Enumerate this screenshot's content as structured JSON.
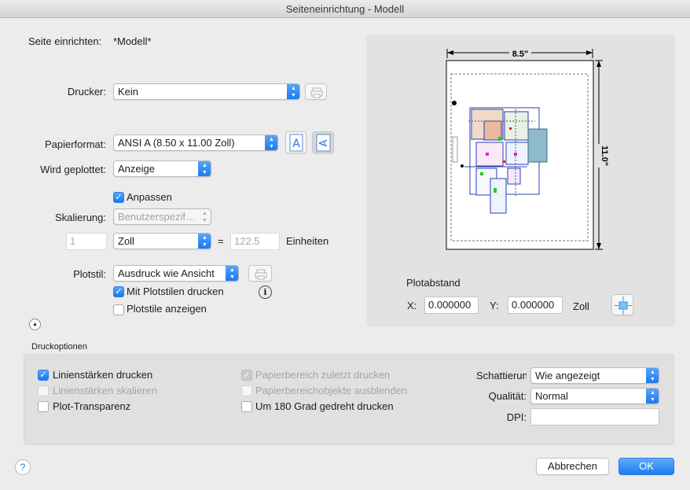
{
  "window": {
    "title": "Seiteneinrichtung - Modell"
  },
  "setup": {
    "label": "Seite einrichten:",
    "value": "*Modell*"
  },
  "printer": {
    "label": "Drucker:",
    "value": "Kein",
    "properties_icon": "printer-properties-icon"
  },
  "paper": {
    "label": "Papierformat:",
    "value": "ANSI A (8.50 x 11.00 Zoll)",
    "portrait_icon": "portrait-orientation-icon",
    "landscape_icon": "landscape-orientation-icon"
  },
  "plot_area": {
    "label": "Wird geplottet:",
    "value": "Anzeige"
  },
  "fit": {
    "label": "Anpassen",
    "checked": true
  },
  "scale": {
    "label": "Skalierung:",
    "preset": "Benutzerspezif…",
    "value_left": "1",
    "unit": "Zoll",
    "equals": "=",
    "value_right": "122.5",
    "units_label": "Einheiten"
  },
  "plotstyle": {
    "label": "Plotstil:",
    "value": "Ausdruck wie Ansicht",
    "edit_icon": "plotstyle-edit-icon",
    "info_icon": "info-icon",
    "with_styles": {
      "label": "Mit Plotstilen drucken",
      "checked": true
    },
    "show_styles": {
      "label": "Plotstile anzeigen",
      "checked": false
    }
  },
  "collapse_icon": "collapse-up-icon",
  "preview": {
    "width_label": "8.5\"",
    "height_label": "11.0\"",
    "offset": {
      "title": "Plotabstand",
      "x_label": "X:",
      "x_value": "0.000000",
      "y_label": "Y:",
      "y_value": "0.000000",
      "unit": "Zoll",
      "center_icon": "center-plot-icon"
    }
  },
  "options": {
    "title": "Druckoptionen",
    "lineweights": {
      "label": "Linienstärken drucken",
      "checked": true,
      "enabled": true
    },
    "scale_lineweights": {
      "label": "Linienstärken skalieren",
      "checked": false,
      "enabled": false
    },
    "transparency": {
      "label": "Plot-Transparenz",
      "checked": false,
      "enabled": true
    },
    "paperspace_last": {
      "label": "Papierbereich zuletzt drucken",
      "checked": true,
      "enabled": false
    },
    "hide_objects": {
      "label": "Papierbereichobjekte ausblenden",
      "checked": false,
      "enabled": false
    },
    "rotate": {
      "label": "Um 180 Grad gedreht drucken",
      "checked": false,
      "enabled": true
    },
    "shading": {
      "label": "Schattierung",
      "value": "Wie angezeigt"
    },
    "quality": {
      "label": "Qualität:",
      "value": "Normal"
    },
    "dpi": {
      "label": "DPI:",
      "value": ""
    }
  },
  "buttons": {
    "help": "?",
    "cancel": "Abbrechen",
    "ok": "OK"
  },
  "colors": {
    "accent": "#1a7cf1",
    "panel": "#e2e2e2",
    "window": "#ececec"
  }
}
